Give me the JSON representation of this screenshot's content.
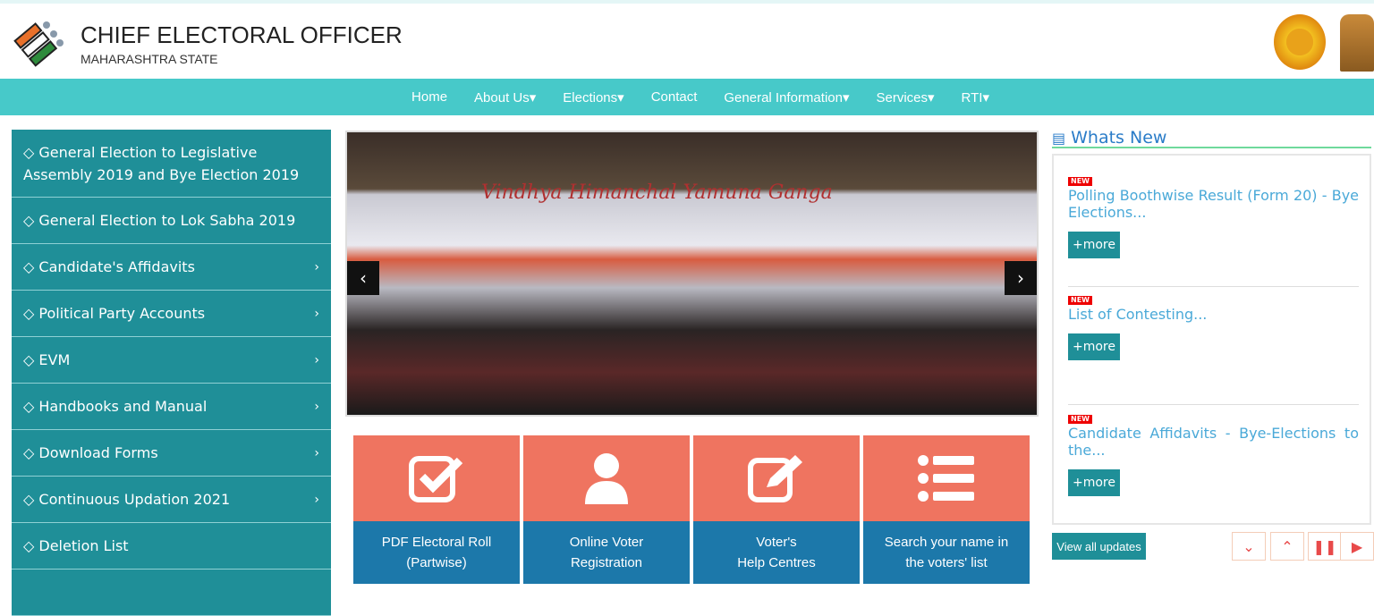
{
  "header": {
    "title": "CHIEF ELECTORAL OFFICER",
    "subtitle": "MAHARASHTRA STATE"
  },
  "nav": [
    {
      "label": "Home"
    },
    {
      "label": "About Us▾"
    },
    {
      "label": "Elections▾"
    },
    {
      "label": "Contact"
    },
    {
      "label": "General Information▾"
    },
    {
      "label": "Services▾"
    },
    {
      "label": "RTI▾"
    }
  ],
  "sidebar": [
    {
      "label": "General Election to Legislative Assembly 2019 and Bye Election 2019",
      "arrow": ""
    },
    {
      "label": "General Election to Lok Sabha 2019",
      "arrow": ""
    },
    {
      "label": " Candidate's Affidavits",
      "arrow": "›"
    },
    {
      "label": "Political Party Accounts",
      "arrow": "›"
    },
    {
      "label": " EVM",
      "arrow": "›"
    },
    {
      "label": "Handbooks and Manual",
      "arrow": "›"
    },
    {
      "label": "Download Forms",
      "arrow": "›"
    },
    {
      "label": "Continuous Updation 2021",
      "arrow": "›"
    },
    {
      "label": "Deletion List",
      "arrow": ""
    }
  ],
  "carousel": {
    "banner_text": "Vindhya Himanchal Yamuna Ganga",
    "prev": "‹",
    "next": "›"
  },
  "tiles": [
    {
      "label": "PDF Electoral Roll\n(Partwise)",
      "icon": "checkbox-icon"
    },
    {
      "label": "Online Voter\nRegistration",
      "icon": "user-icon"
    },
    {
      "label": "Voter's\nHelp Centres",
      "icon": "edit-icon"
    },
    {
      "label": "Search your name in\nthe voters' list",
      "icon": "list-icon"
    }
  ],
  "whats_new": {
    "title": "Whats New",
    "new_tag": "NEW",
    "more_label": "+more",
    "items": [
      {
        "text": "Polling Boothwise Result (Form 20) - Bye Elections..."
      },
      {
        "text": "List of Contesting..."
      },
      {
        "text": "Candidate Affidavits - Bye-Elections to the..."
      }
    ],
    "view_all": "View all updates",
    "controls": {
      "down": "⌄",
      "up": "⌃",
      "pause": "❚❚",
      "play": "▶"
    }
  },
  "colors": {
    "nav": "#47c9c9",
    "sidebar": "#1f8f98",
    "tile_top": "#ef7460",
    "tile_bottom": "#1c78aa",
    "link": "#4aa9d8"
  }
}
